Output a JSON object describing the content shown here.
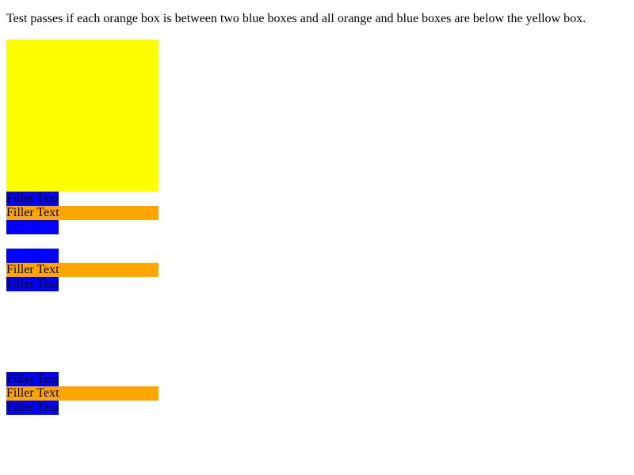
{
  "instruction": "Test passes if each orange box is between two blue boxes and all orange and blue boxes are below the yellow box.",
  "colors": {
    "yellow": "#ffff00",
    "blue": "#0000ff",
    "orange": "#ffa500"
  },
  "groups": [
    {
      "top": {
        "text": "Filler Text"
      },
      "middle": {
        "text": "Filler Text"
      },
      "bottom": {
        "text": ""
      }
    },
    {
      "top": {
        "text": ""
      },
      "middle": {
        "text": "Filler Text"
      },
      "bottom": {
        "text": "Filler Text"
      }
    },
    {
      "top": {
        "text": "Filler Text"
      },
      "middle": {
        "text": "Filler Text"
      },
      "bottom": {
        "text": "Filler Text"
      }
    }
  ]
}
